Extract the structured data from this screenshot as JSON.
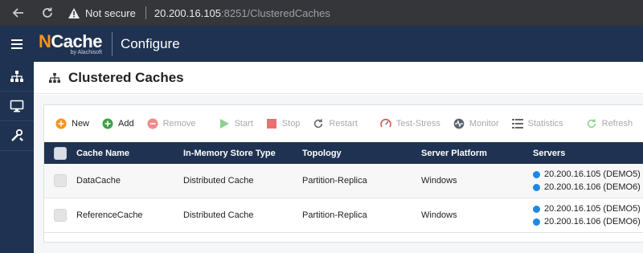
{
  "browser": {
    "security_label": "Not secure",
    "url_host": "20.200.16.105",
    "url_rest": ":8251/ClusteredCaches"
  },
  "app": {
    "logo_text_n": "N",
    "logo_text_rest": "Cache",
    "logo_byline": "by Alachisoft",
    "section": "Configure"
  },
  "page": {
    "title": "Clustered Caches"
  },
  "toolbar": {
    "new": "New",
    "add": "Add",
    "remove": "Remove",
    "start": "Start",
    "stop": "Stop",
    "restart": "Restart",
    "test_stress": "Test-Stress",
    "monitor": "Monitor",
    "statistics": "Statistics",
    "refresh": "Refresh"
  },
  "table": {
    "headers": [
      "Cache Name",
      "In-Memory Store Type",
      "Topology",
      "Server Platform",
      "Servers"
    ],
    "rows": [
      {
        "name": "DataCache",
        "store": "Distributed Cache",
        "topology": "Partition-Replica",
        "platform": "Windows",
        "servers": [
          "20.200.16.105 (DEMO5)",
          "20.200.16.106 (DEMO6)"
        ]
      },
      {
        "name": "ReferenceCache",
        "store": "Distributed Cache",
        "topology": "Partition-Replica",
        "platform": "Windows",
        "servers": [
          "20.200.16.105 (DEMO5)",
          "20.200.16.106 (DEMO6)"
        ]
      }
    ]
  },
  "colors": {
    "header_bg": "#1f3251",
    "accent_orange": "#f7941d",
    "server_dot": "#1e88e5"
  }
}
